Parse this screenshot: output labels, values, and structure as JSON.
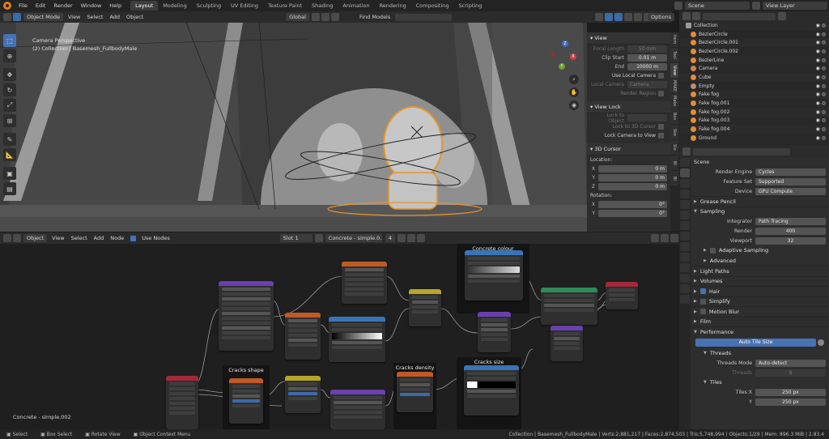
{
  "topbar": {
    "menus": [
      "File",
      "Edit",
      "Render",
      "Window",
      "Help"
    ],
    "workspaces": [
      "Layout",
      "Modeling",
      "Sculpting",
      "UV Editing",
      "Texture Paint",
      "Shading",
      "Animation",
      "Rendering",
      "Compositing",
      "Scripting"
    ],
    "active_workspace": "Layout",
    "scene_label": "Scene",
    "view_layer_label": "View Layer"
  },
  "viewport": {
    "mode": "Object Mode",
    "menus": [
      "View",
      "Select",
      "Add",
      "Object"
    ],
    "orientation": "Global",
    "find_models": "Find Models",
    "options_label": "Options",
    "overlay_title": "Camera Perspective",
    "overlay_sub": "(2) Collection | Basemesh_FullbodyMale",
    "gizmo_axes": [
      "X",
      "Y",
      "Z"
    ]
  },
  "npanel": {
    "tabs": [
      "Item",
      "Tool",
      "View",
      "MAKE",
      "Make",
      "Box",
      "Ske",
      "Slo",
      "Bl",
      "Bl"
    ],
    "view": {
      "header": "View",
      "focal_length_label": "Focal Length",
      "focal_length_value": "50 mm",
      "clip_start_label": "Clip Start",
      "clip_start_value": "0.01 m",
      "clip_end_label": "End",
      "clip_end_value": "10000 m",
      "use_local_camera": "Use Local Camera",
      "local_camera_label": "Local Camera",
      "local_camera_value": "Camera",
      "render_region": "Render Region"
    },
    "view_lock": {
      "header": "View Lock",
      "lock_to_object": "Lock to Object",
      "lock_to_3d_cursor": "Lock to 3D Cursor",
      "lock_camera_to_view": "Lock Camera to View"
    },
    "cursor": {
      "header": "3D Cursor",
      "location_label": "Location:",
      "x_label": "X",
      "x_value": "0 m",
      "y_label": "Y",
      "y_value": "0 m",
      "z_label": "Z",
      "z_value": "0 m",
      "rotation_label": "Rotation:",
      "rx_label": "X",
      "rx_value": "0°",
      "ry_label": "Y",
      "ry_value": "0°"
    }
  },
  "outliner": {
    "items": [
      {
        "name": "Collection",
        "type": "col"
      },
      {
        "name": "BezierCircle",
        "type": "obj"
      },
      {
        "name": "BezierCircle.001",
        "type": "obj"
      },
      {
        "name": "BezierCircle.002",
        "type": "obj"
      },
      {
        "name": "BezierLine",
        "type": "obj"
      },
      {
        "name": "Camera",
        "type": "cam"
      },
      {
        "name": "Cube",
        "type": "obj"
      },
      {
        "name": "Empty",
        "type": "empty"
      },
      {
        "name": "Fake fog",
        "type": "obj"
      },
      {
        "name": "Fake fog.001",
        "type": "obj"
      },
      {
        "name": "Fake fog.002",
        "type": "obj"
      },
      {
        "name": "Fake fog.003",
        "type": "obj"
      },
      {
        "name": "Fake fog.004",
        "type": "obj"
      },
      {
        "name": "Ground",
        "type": "obj"
      }
    ]
  },
  "properties": {
    "scene_name": "Scene",
    "render_engine_label": "Render Engine",
    "render_engine_value": "Cycles",
    "feature_set_label": "Feature Set",
    "feature_set_value": "Supported",
    "device_label": "Device",
    "device_value": "GPU Compute",
    "grease_pencil": "Grease Pencil",
    "sampling": "Sampling",
    "integrator_label": "Integrator",
    "integrator_value": "Path Tracing",
    "render_label": "Render",
    "render_value": "400",
    "viewport_label": "Viewport",
    "viewport_value": "32",
    "adaptive_sampling": "Adaptive Sampling",
    "advanced": "Advanced",
    "light_paths": "Light Paths",
    "volumes": "Volumes",
    "hair": "Hair",
    "simplify": "Simplify",
    "motion_blur": "Motion Blur",
    "film": "Film",
    "performance": "Performance",
    "auto_tile_size": "Auto Tile Size",
    "threads": "Threads",
    "threads_mode_label": "Threads Mode",
    "threads_mode_value": "Auto-detect",
    "threads_label": "Threads",
    "threads_value": "8",
    "tiles": "Tiles",
    "tiles_x_label": "Tiles X",
    "tiles_x_value": "250 px",
    "tiles_y_label": "Y",
    "tiles_y_value": "250 px"
  },
  "node_editor": {
    "type": "Object",
    "menus": [
      "View",
      "Select",
      "Add",
      "Node"
    ],
    "use_nodes": "Use Nodes",
    "slot": "Slot 1",
    "material": "Concrete - simple.0...",
    "users": "4",
    "material_label": "Concrete - simple.002",
    "frames": [
      "Concrete colour",
      "Cracks shape",
      "Cracks density",
      "Cracks size"
    ]
  },
  "status": {
    "select": "Select",
    "box_select": "Box Select",
    "rotate_view": "Rotate View",
    "context_menu": "Object Context Menu",
    "stats": "Collection | Basemesh_FullbodyMale | Verts:2,881,217 | Faces:2,874,503 | Tris:5,748,994 | Objects:1/29 | Mem: 896.3 MiB | 2.83.4"
  },
  "colors": {
    "accent": "#4772b3",
    "selection_orange": "#e8952c",
    "bg": "#1d1d1d"
  }
}
